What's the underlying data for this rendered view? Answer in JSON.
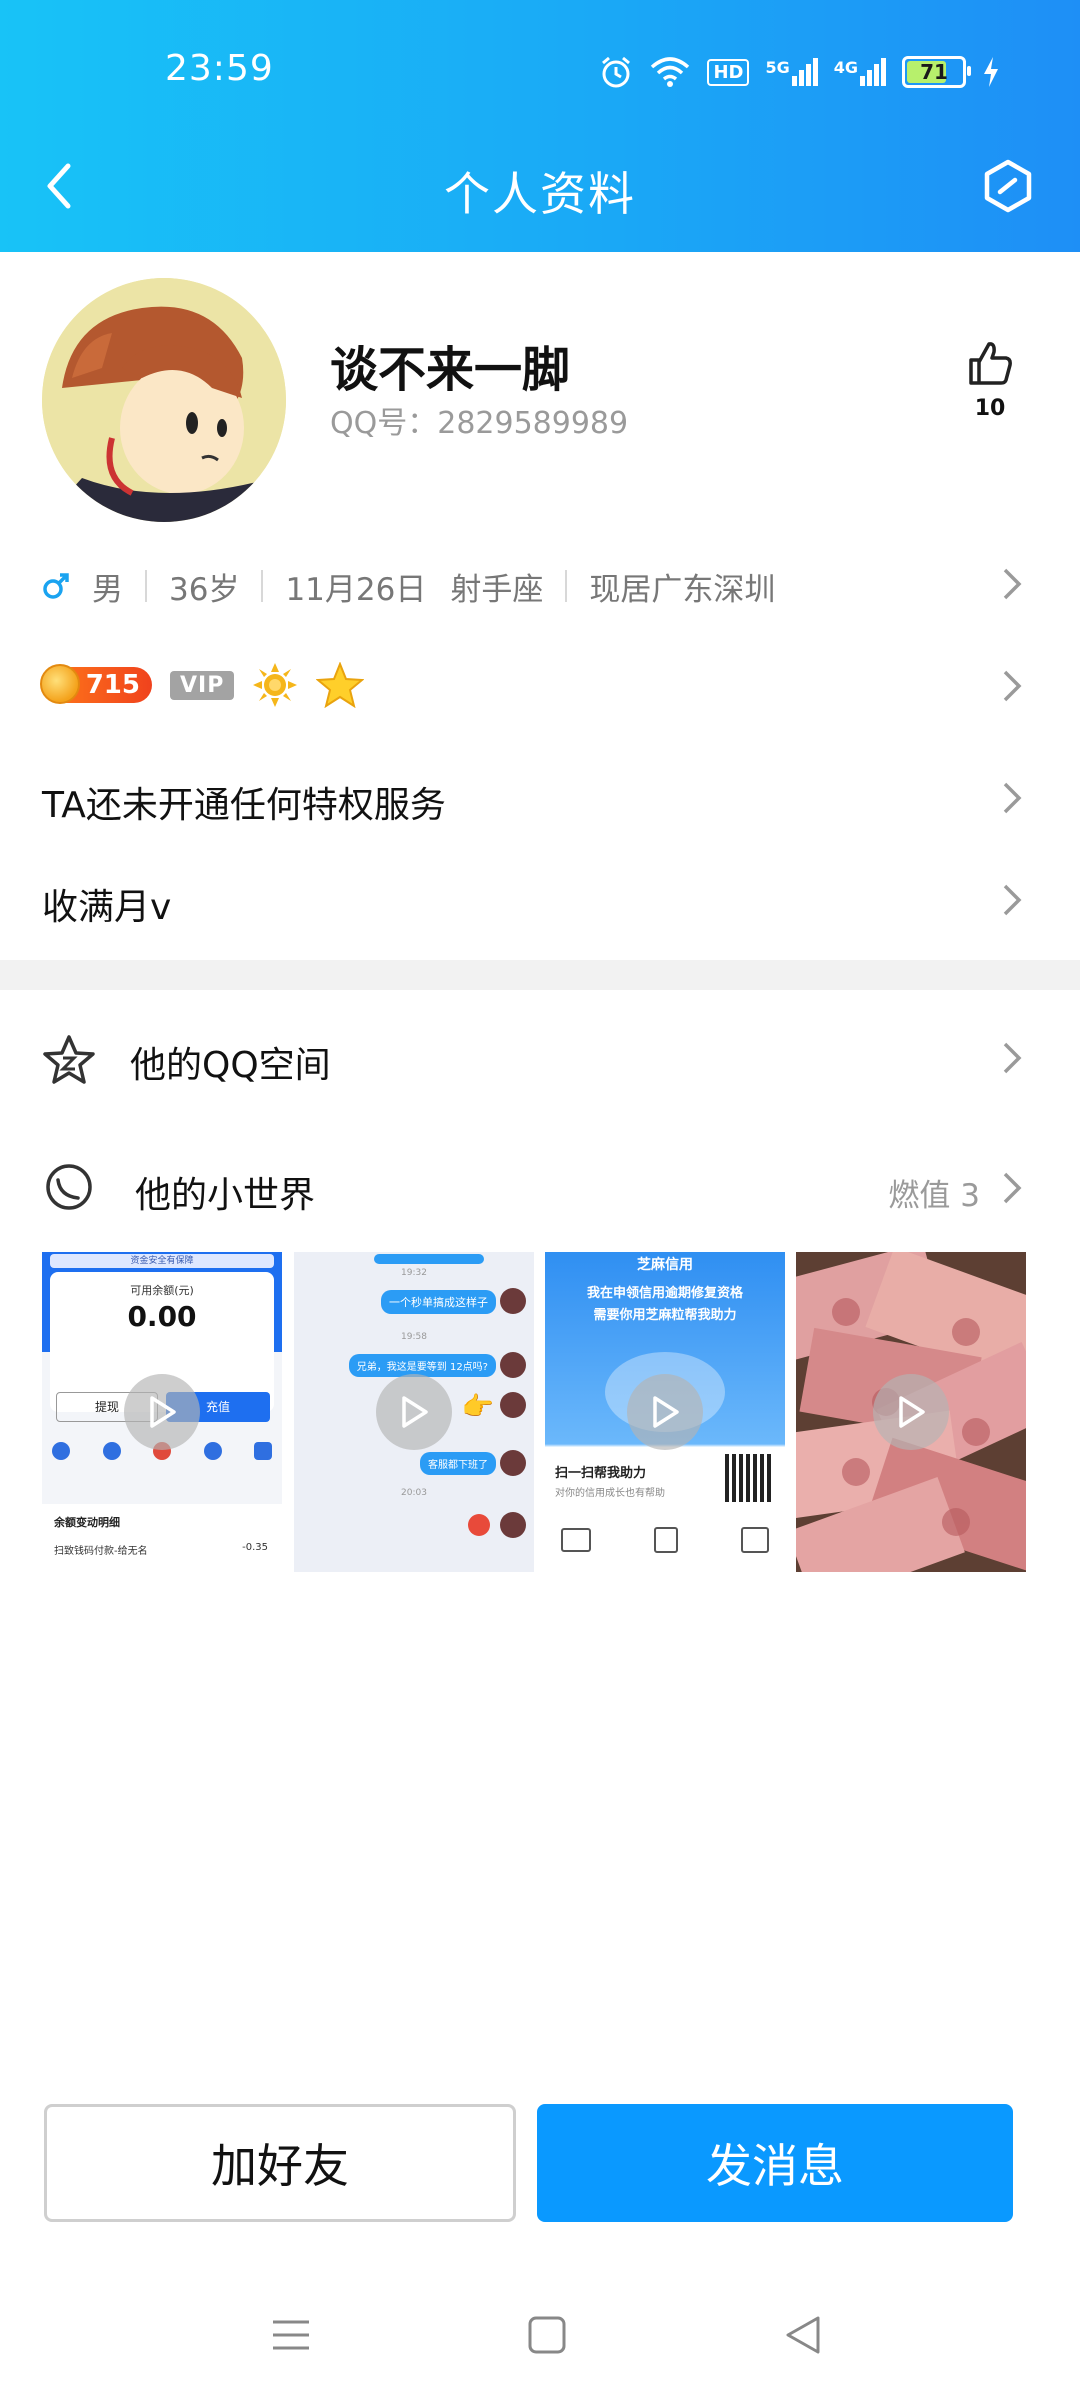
{
  "status_bar": {
    "time": "23:59",
    "battery": "71",
    "network_5g": "5G",
    "network_4g": "4G",
    "hd": "HD"
  },
  "nav": {
    "title": "个人资料"
  },
  "profile": {
    "nickname": "谈不来一脚",
    "qq_label": "QQ号：",
    "qq_number": "2829589989",
    "like_count": "10"
  },
  "info": {
    "gender": "男",
    "age": "36岁",
    "birthday": "11月26日",
    "constellation": "射手座",
    "location": "现居广东深圳"
  },
  "badges": {
    "level": "715",
    "vip": "VIP"
  },
  "rows": {
    "privilege": "TA还未开通任何特权服务",
    "signature": "收满月v"
  },
  "sections": {
    "qzone": "他的QQ空间",
    "world": "他的小世界",
    "burn_label": "燃值 3"
  },
  "thumbs": [
    {
      "balance_label": "可用余额(元)",
      "balance": "0.00",
      "withdraw": "提现",
      "recharge": "充值",
      "detail_title": "余额变动明细",
      "detail_item": "扫致钱码付款-给无名",
      "detail_amount": "-0.35",
      "top": "资金安全有保障"
    },
    {
      "msg1": "一个秒单搞成这样子",
      "msg2": "兄弟，我这是要等到 12点吗?",
      "msg3": "客服都下班了",
      "t1": "19:32",
      "t2": "19:58",
      "t3": "20:03"
    },
    {
      "brand": "芝麻信用",
      "line1": "我在申领信用逾期修复资格",
      "line2": "需要你用芝麻粒帮我助力",
      "scan": "扫一扫帮我助力",
      "sub": "对你的信用成长也有帮助"
    },
    {}
  ],
  "buttons": {
    "add_friend": "加好友",
    "send_message": "发消息"
  },
  "colors": {
    "header_start": "#18c3f7",
    "header_end": "#1e8ff6",
    "primary_button": "#0a99ff",
    "level_pill": "#f0421d"
  }
}
